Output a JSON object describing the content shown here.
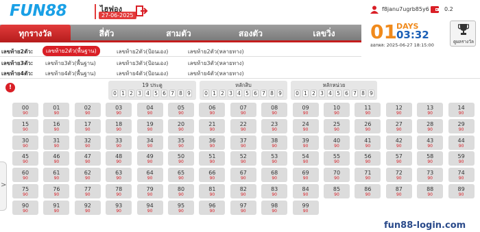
{
  "header": {
    "logo": "FUN88",
    "lottery_name": "ไฮฟอง",
    "lottery_date": "27-06-2025",
    "exit_icon": "exit-icon",
    "username": "f8janu7ugrb85y6",
    "balance": "0.2",
    "user_icon": "user-icon",
    "wallet_icon": "wallet-icon"
  },
  "tabs": [
    {
      "label": "ทุกรางวัล",
      "active": true
    },
    {
      "label": "สี่ตัว",
      "active": false
    },
    {
      "label": "สามตัว",
      "active": false
    },
    {
      "label": "สองตัว",
      "active": false
    },
    {
      "label": "เลขวิ่ง",
      "active": false
    }
  ],
  "timer": {
    "days_value": "01",
    "days_label": "DAYS",
    "clock": "03:32",
    "close_time": "ออกผล: 2025-06-27 18:15:00"
  },
  "results_button": {
    "label": "ดูผลรางวัล",
    "icon": "trophy-icon"
  },
  "bet_rows": [
    {
      "label": "เลขท้าย2ตัว:",
      "options": [
        "เลขท้าย2ตัว(พื้นฐาน)",
        "เลขท้าย2ตัว(ป้อนเอง)",
        "เลขท้าย2ตัว(หลายทาง)"
      ],
      "selected": 0
    },
    {
      "label": "เลขท้าย3ตัว:",
      "options": [
        "เลขท้าย3ตัว(พื้นฐาน)",
        "เลขท้าย3ตัว(ป้อนเอง)",
        "เลขท้าย3ตัว(หลายทาง)"
      ],
      "selected": -1
    },
    {
      "label": "เลขท้าย4ตัว:",
      "options": [
        "เลขท้าย4ตัว(พื้นฐาน)",
        "เลขท้าย4ตัว(ป้อนเอง)",
        "เลขท้าย4ตัว(หลายทาง)"
      ],
      "selected": -1
    }
  ],
  "info_icon": "!",
  "pickers": [
    {
      "title": "19 ประตู",
      "digits": [
        "0",
        "1",
        "2",
        "3",
        "4",
        "5",
        "6",
        "7",
        "8",
        "9"
      ]
    },
    {
      "title": "หลักสิบ",
      "digits": [
        "0",
        "1",
        "2",
        "3",
        "4",
        "5",
        "6",
        "7",
        "8",
        "9"
      ]
    },
    {
      "title": "หลักหน่วย",
      "digits": [
        "0",
        "1",
        "2",
        "3",
        "4",
        "5",
        "6",
        "7",
        "8",
        "9"
      ]
    }
  ],
  "grid": {
    "odds_label": "90",
    "numbers": [
      "00",
      "01",
      "02",
      "03",
      "04",
      "05",
      "06",
      "07",
      "08",
      "09",
      "10",
      "11",
      "12",
      "13",
      "14",
      "15",
      "16",
      "17",
      "18",
      "19",
      "20",
      "21",
      "22",
      "23",
      "24",
      "25",
      "26",
      "27",
      "28",
      "29",
      "30",
      "31",
      "32",
      "33",
      "34",
      "35",
      "36",
      "37",
      "38",
      "39",
      "40",
      "41",
      "42",
      "43",
      "44",
      "45",
      "46",
      "47",
      "48",
      "49",
      "50",
      "51",
      "52",
      "53",
      "54",
      "55",
      "56",
      "57",
      "58",
      "59",
      "60",
      "61",
      "62",
      "63",
      "64",
      "65",
      "66",
      "67",
      "68",
      "69",
      "70",
      "71",
      "72",
      "73",
      "74",
      "75",
      "76",
      "77",
      "78",
      "79",
      "80",
      "81",
      "82",
      "83",
      "84",
      "85",
      "86",
      "87",
      "88",
      "89",
      "90",
      "91",
      "92",
      "93",
      "94",
      "95",
      "96",
      "97",
      "98",
      "99"
    ]
  },
  "side_arrow": ">",
  "watermark": "fun88-login.com",
  "colors": {
    "accent_red": "#d91f26",
    "brand_blue": "#1aa0e6",
    "timer_orange": "#f08a1c",
    "timer_blue": "#1b5fb6"
  }
}
